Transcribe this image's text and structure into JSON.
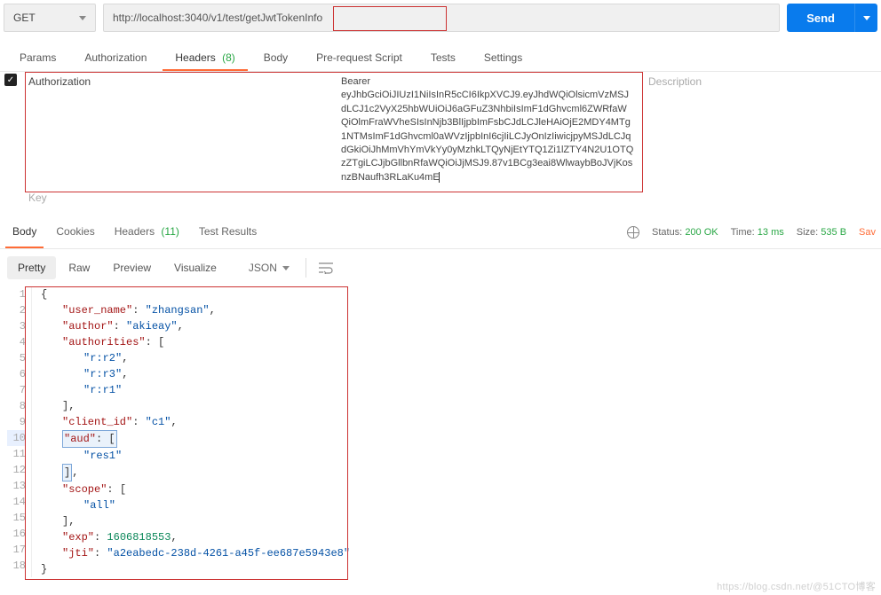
{
  "request": {
    "method": "GET",
    "url": "http://localhost:3040/v1/test/getJwtTokenInfo",
    "send_label": "Send"
  },
  "req_tabs": {
    "params": "Params",
    "authorization": "Authorization",
    "headers": "Headers",
    "headers_badge": "(8)",
    "body": "Body",
    "prerequest": "Pre-request Script",
    "tests": "Tests",
    "settings": "Settings"
  },
  "header_row": {
    "key": "Authorization",
    "key_placeholder": "Key",
    "value_prefix": "Bearer",
    "value_token": "eyJhbGciOiJIUzI1NiIsInR5cCI6IkpXVCJ9.eyJhdWQiOlsicmVzMSJdLCJ1c2VyX25hbWUiOiJ6aGFuZ3NhbiIsImF1dGhvcml6ZWRfaWQiOlmFraWVheSIsInNjb3BlIjpbImFsbCJdLCJleHAiOjE2MDY4MTg1NTMsImF1dGhvcml0aWVzIjpbInI6cjIiLCJyOnIzIiwicjpyMSJdLCJqdGkiOiJhMmVhYmVkYy0yMzhkLTQyNjEtYTQ1Zi1lZTY4N2U1OTQzZTgiLCJjbGllbnRfaWQiOiJjMSJ9.87v1BCg3eai8WlwaybBoJVjKosnzBNaufh3RLaKu4mE",
    "desc_placeholder": "Description"
  },
  "resp_tabs": {
    "body": "Body",
    "cookies": "Cookies",
    "headers": "Headers",
    "headers_badge": "(11)",
    "test_results": "Test Results"
  },
  "resp_meta": {
    "status_label": "Status:",
    "status_value": "200 OK",
    "time_label": "Time:",
    "time_value": "13 ms",
    "size_label": "Size:",
    "size_value": "535 B",
    "save_label": "Sav"
  },
  "view_toolbar": {
    "pretty": "Pretty",
    "raw": "Raw",
    "preview": "Preview",
    "visualize": "Visualize",
    "format": "JSON"
  },
  "json_lines": [
    {
      "n": "1",
      "indent": 0,
      "html": "<span class='p'>{</span>"
    },
    {
      "n": "2",
      "indent": 1,
      "html": "<span class='k'>\"user_name\"</span><span class='p'>: </span><span class='s'>\"zhangsan\"</span><span class='p'>,</span>"
    },
    {
      "n": "3",
      "indent": 1,
      "html": "<span class='k'>\"author\"</span><span class='p'>: </span><span class='s'>\"akieay\"</span><span class='p'>,</span>"
    },
    {
      "n": "4",
      "indent": 1,
      "html": "<span class='k'>\"authorities\"</span><span class='p'>: [</span>"
    },
    {
      "n": "5",
      "indent": 2,
      "html": "<span class='s'>\"r:r2\"</span><span class='p'>,</span>"
    },
    {
      "n": "6",
      "indent": 2,
      "html": "<span class='s'>\"r:r3\"</span><span class='p'>,</span>"
    },
    {
      "n": "7",
      "indent": 2,
      "html": "<span class='s'>\"r:r1\"</span>"
    },
    {
      "n": "8",
      "indent": 1,
      "html": "<span class='p'>],</span>"
    },
    {
      "n": "9",
      "indent": 1,
      "html": "<span class='k'>\"client_id\"</span><span class='p'>: </span><span class='s'>\"c1\"</span><span class='p'>,</span>"
    },
    {
      "n": "10",
      "indent": 1,
      "selected": true,
      "html": "<span class='sel-box'><span class='k'>\"aud\"</span><span class='p'>: [</span></span>"
    },
    {
      "n": "11",
      "indent": 2,
      "html": "<span class='s'>\"res1\"</span>"
    },
    {
      "n": "12",
      "indent": 1,
      "html": "<span class='sel-box'><span class='p'>]</span></span><span class='p'>,</span>"
    },
    {
      "n": "13",
      "indent": 1,
      "html": "<span class='k'>\"scope\"</span><span class='p'>: [</span>"
    },
    {
      "n": "14",
      "indent": 2,
      "html": "<span class='s'>\"all\"</span>"
    },
    {
      "n": "15",
      "indent": 1,
      "html": "<span class='p'>],</span>"
    },
    {
      "n": "16",
      "indent": 1,
      "html": "<span class='k'>\"exp\"</span><span class='p'>: </span><span class='n'>1606818553</span><span class='p'>,</span>"
    },
    {
      "n": "17",
      "indent": 1,
      "html": "<span class='k'>\"jti\"</span><span class='p'>: </span><span class='s'>\"a2eabedc-238d-4261-a45f-ee687e5943e8\"</span>"
    },
    {
      "n": "18",
      "indent": 0,
      "html": "<span class='p'>}</span>"
    }
  ],
  "watermark": "https://blog.csdn.net/@51CTO博客"
}
